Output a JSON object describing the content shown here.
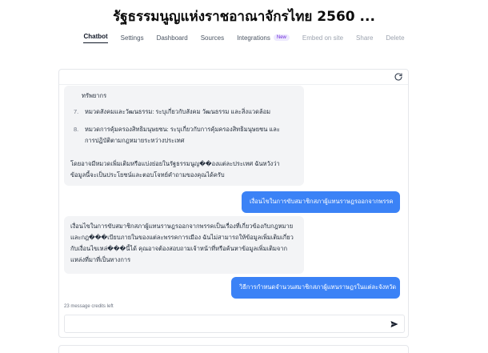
{
  "header": {
    "title": "รัฐธรรมนูญแห่งราชอาณาจักรไทย 2560 ..."
  },
  "tabs": [
    {
      "label": "Chatbot",
      "active": true
    },
    {
      "label": "Settings"
    },
    {
      "label": "Dashboard"
    },
    {
      "label": "Sources"
    },
    {
      "label": "Integrations",
      "badge": "New"
    },
    {
      "label": "Embed on site"
    },
    {
      "label": "Share"
    },
    {
      "label": "Delete"
    }
  ],
  "chat": {
    "bot_message_1": {
      "fragment": "ทรัพยากร",
      "items": [
        {
          "num": "7.",
          "text": "หมวดสังคมและวัฒนธรรม: ระบุเกี่ยวกับสังคม วัฒนธรรม และสิ่งแวดล้อม"
        },
        {
          "num": "8.",
          "text": "หมวดการคุ้มครองสิทธิมนุษยชน: ระบุเกี่ยวกับการคุ้มครองสิทธิมนุษยชน และการปฏิบัติตามกฎหมายระหว่างประเทศ"
        }
      ],
      "closing": "โดยอาจมีหมวดเพิ่มเติมหรือแบ่งย่อยในรัฐธรรมนูญ��องแต่ละประเทศ ฉันหวังว่าข้อมูลนี้จะเป็นประโยชน์และตอบโจทย์คำถามของคุณได้ครับ"
    },
    "user_message_1": "เงื่อนไขในการขับสมาชิกสภาผู้แทนราษฎรออกจากพรรค",
    "bot_message_2": "เงื่อนไขในการขับสมาชิกสภาผู้แทนราษฎรออกจากพรรคเป็นเรื่องที่เกี่ยวข้องกับกฎหมายและกฎ���เบียบภายในของแต่ละพรรคการเมือง ฉันไม่สามารถให้ข้อมูลเพิ่มเติมเกี่ยวกับเงื่อนไขเหล่���นี้ได้ คุณอาจต้องสอบถามเจ้าหน้าที่หรือค้นหาข้อมูลเพิ่มเติมจากแหล่งที่มาที่เป็นทางการ",
    "user_message_2": "วิธีการกำหนดจำนวนสมาชิกสภาผู้แทนราษฎรในแต่ละจังหวัด"
  },
  "footer": {
    "credits": "23 message credits left",
    "input_value": "",
    "input_placeholder": ""
  },
  "icons": {
    "refresh": "refresh-icon",
    "send": "send-icon",
    "scroll_down": "chevron-down-icon"
  },
  "colors": {
    "user_bubble": "#3b82f6",
    "bot_bubble": "#f3f4f6",
    "badge_bg": "#ede9fe",
    "badge_text": "#6d28d9"
  }
}
